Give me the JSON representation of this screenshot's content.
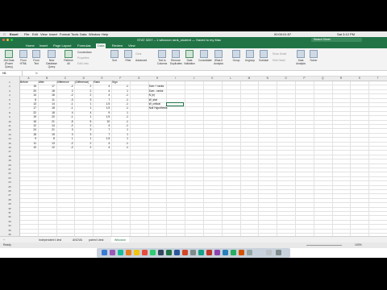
{
  "menubar": {
    "apple": "",
    "app": "Excel",
    "items": [
      "File",
      "Edit",
      "View",
      "Insert",
      "Format",
      "Tools",
      "Data",
      "Window",
      "Help"
    ],
    "clock": "Sat 3:12 PM",
    "timer": "00:00:01:57"
  },
  "window": {
    "title": "STAT 3207 – 1 wilcoxon rank_student — Saved to my Mac"
  },
  "search": {
    "placeholder": "Search Sheet"
  },
  "tabs": [
    "Home",
    "Insert",
    "Page Layout",
    "Formulas",
    "Data",
    "Review",
    "View"
  ],
  "active_tab": "Data",
  "ribbon": {
    "buttons": [
      {
        "label": "Get Data (Power Query)"
      },
      {
        "label": "From HTML"
      },
      {
        "label": "From Text"
      },
      {
        "label": "New Database Query"
      },
      {
        "label": "Refresh All"
      },
      {
        "label": "Connections"
      },
      {
        "label": "Properties"
      },
      {
        "label": "Edit Links"
      },
      {
        "label": "Sort"
      },
      {
        "label": "Filter"
      },
      {
        "label": "Clear"
      },
      {
        "label": "Advanced"
      },
      {
        "label": "Text to Columns"
      },
      {
        "label": "Remove Duplicates"
      },
      {
        "label": "Data Validation"
      },
      {
        "label": "Consolidate"
      },
      {
        "label": "What-If Analysis"
      },
      {
        "label": "Group"
      },
      {
        "label": "Ungroup"
      },
      {
        "label": "Subtotal"
      },
      {
        "label": "Show Detail"
      },
      {
        "label": "Hide Detail"
      },
      {
        "label": "Data Analysis"
      },
      {
        "label": "Solver"
      }
    ]
  },
  "formula": {
    "namebox": "H6",
    "fx": "fx"
  },
  "columns": [
    "A",
    "B",
    "C",
    "D",
    "E",
    "F",
    "G",
    "H",
    "I",
    "J",
    "K",
    "L",
    "M",
    "N",
    "O",
    "P",
    "Q",
    "R",
    "S",
    "T"
  ],
  "headers": [
    "Before",
    "After",
    "Difference",
    "|Difference|",
    "Rank",
    "Sign"
  ],
  "rows": [
    [
      "1",
      "",
      "",
      "",
      "",
      ""
    ],
    [
      "2",
      "",
      "",
      "",
      "",
      ""
    ],
    [
      "3",
      "",
      "",
      "",
      "",
      ""
    ],
    [
      "4",
      "",
      "",
      "",
      "",
      ""
    ],
    [
      "5",
      "",
      "",
      "",
      "",
      ""
    ],
    [
      "6",
      "",
      "",
      "",
      "",
      ""
    ],
    [
      "7",
      "",
      "",
      "",
      "",
      ""
    ],
    [
      "8",
      "",
      "",
      "",
      "",
      ""
    ],
    [
      "9",
      "",
      "",
      "",
      "",
      ""
    ],
    [
      "10",
      "",
      "",
      "",
      "",
      ""
    ],
    [
      "11",
      "",
      "",
      "",
      "",
      ""
    ],
    [
      "12",
      "",
      "",
      "",
      "",
      ""
    ],
    [
      "13",
      "",
      "",
      "",
      "",
      ""
    ],
    [
      "14",
      "",
      "",
      "",
      "",
      ""
    ],
    [
      "15",
      "",
      "",
      "",
      "",
      ""
    ]
  ],
  "table": [
    [
      "15",
      "17",
      "-2",
      "2",
      "4",
      "-1"
    ],
    [
      "20",
      "18",
      "2",
      "2",
      "4",
      "1"
    ],
    [
      "14",
      "16",
      "-2",
      "2",
      "4",
      "-1"
    ],
    [
      "8",
      "11",
      "-3",
      "3",
      "7",
      "-1"
    ],
    [
      "13",
      "14",
      "-1",
      "1",
      "1.5",
      "-1"
    ],
    [
      "17",
      "18",
      "-1",
      "1",
      "1.5",
      "-1"
    ],
    [
      "22",
      "18",
      "4",
      "4",
      "9",
      "1"
    ],
    [
      "19",
      "20",
      "-1",
      "1",
      "1.5",
      "-1"
    ],
    [
      "16",
      "21",
      "-5",
      "5",
      "10",
      "-1"
    ],
    [
      "12",
      "14",
      "-2",
      "2",
      "4",
      "-1"
    ],
    [
      "24",
      "21",
      "3",
      "3",
      "7",
      "1"
    ],
    [
      "18",
      "15",
      "3",
      "3",
      "7",
      "1"
    ],
    [
      "9",
      "8",
      "1",
      "1",
      "1.5",
      "1"
    ],
    [
      "11",
      "13",
      "-2",
      "2",
      "4",
      "-1"
    ],
    [
      "10",
      "12",
      "-2",
      "2",
      "4",
      "-1"
    ]
  ],
  "side_labels": [
    "Sum + ranks",
    "Sum - ranks",
    "N (n)",
    "W_stat",
    "W_critical",
    "Null Hypothesis"
  ],
  "side_values": [
    "",
    "",
    "",
    "",
    "",
    ""
  ],
  "sheets": [
    "Independent t-test",
    "ANOVA",
    "paired t-test",
    "Wilcoxon"
  ],
  "active_sheet": "Wilcoxon",
  "status": {
    "left": "Ready",
    "zoom": "100%"
  }
}
